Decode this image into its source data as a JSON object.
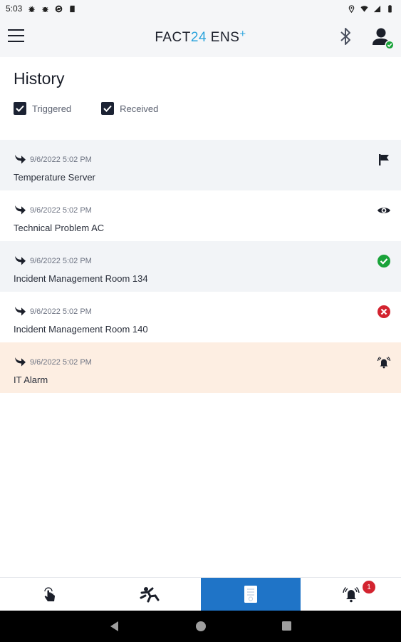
{
  "status_bar": {
    "time": "5:03",
    "left_icons": [
      "bug-icon",
      "bug-icon",
      "sync-icon",
      "sd-card-icon"
    ],
    "right_icons": [
      "location-icon",
      "wifi-icon",
      "signal-icon",
      "battery-icon"
    ]
  },
  "app_bar": {
    "menu_icon": "hamburger-menu-icon",
    "logo": {
      "part_a": "FACT",
      "part_num": "24",
      "part_b": " ENS",
      "part_plus": "+"
    },
    "bluetooth_icon": "bluetooth-icon",
    "profile_icon": "user-online-icon"
  },
  "page": {
    "title": "History",
    "filters": [
      {
        "label": "Triggered",
        "checked": true
      },
      {
        "label": "Received",
        "checked": true
      }
    ]
  },
  "history": [
    {
      "time": "9/6/2022 5:02 PM",
      "title": "Temperature Server",
      "status_icon": "flag-icon",
      "style": "alt"
    },
    {
      "time": "9/6/2022 5:02 PM",
      "title": "Technical Problem AC",
      "status_icon": "eye-icon",
      "style": "white"
    },
    {
      "time": "9/6/2022 5:02 PM",
      "title": "Incident Management Room 134",
      "status_icon": "check-circle-icon",
      "style": "alt"
    },
    {
      "time": "9/6/2022 5:02 PM",
      "title": "Incident Management Room 140",
      "status_icon": "cancel-circle-icon",
      "style": "white"
    },
    {
      "time": "9/6/2022 5:02 PM",
      "title": "IT Alarm",
      "status_icon": "ringing-bell-icon",
      "style": "alarm"
    }
  ],
  "bottom_nav": {
    "tabs": [
      {
        "name": "trigger",
        "icon": "touch-hand-icon",
        "active": false
      },
      {
        "name": "emergency",
        "icon": "falling-person-icon",
        "active": false
      },
      {
        "name": "history",
        "icon": "document-icon",
        "active": true
      },
      {
        "name": "alarms",
        "icon": "ringing-bell-icon",
        "active": false
      }
    ],
    "alarm_badge": "1"
  },
  "colors": {
    "accent": "#1f74c7",
    "brand_blue": "#29a3dc",
    "success": "#1aa33a",
    "error": "#d3232f",
    "alarm_row": "#fdeee2",
    "alt_row": "#f2f4f7"
  }
}
